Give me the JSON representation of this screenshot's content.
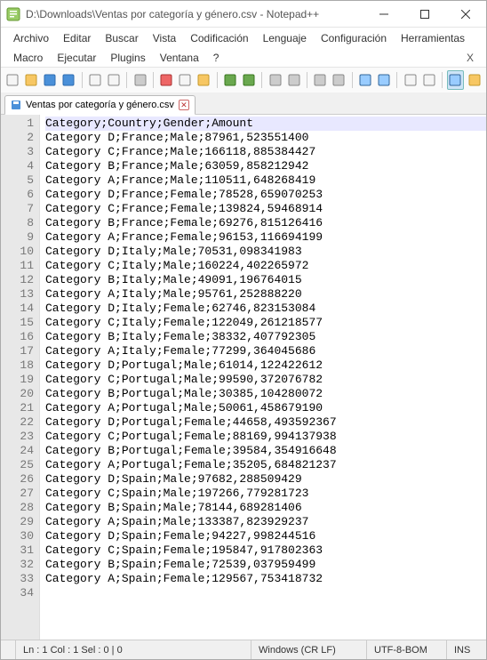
{
  "window": {
    "title": "D:\\Downloads\\Ventas por categoría y género.csv - Notepad++"
  },
  "menu": {
    "row1": [
      "Archivo",
      "Editar",
      "Buscar",
      "Vista",
      "Codificación",
      "Lenguaje",
      "Configuración",
      "Herramientas"
    ],
    "row2": [
      "Macro",
      "Ejecutar",
      "Plugins",
      "Ventana",
      "?"
    ]
  },
  "tab": {
    "label": "Ventas por categoría y género.csv"
  },
  "editor": {
    "lines": [
      "Category;Country;Gender;Amount",
      "Category D;France;Male;87961,523551400",
      "Category C;France;Male;166118,885384427",
      "Category B;France;Male;63059,858212942",
      "Category A;France;Male;110511,648268419",
      "Category D;France;Female;78528,659070253",
      "Category C;France;Female;139824,59468914",
      "Category B;France;Female;69276,815126416",
      "Category A;France;Female;96153,116694199",
      "Category D;Italy;Male;70531,098341983",
      "Category C;Italy;Male;160224,402265972",
      "Category B;Italy;Male;49091,196764015",
      "Category A;Italy;Male;95761,252888220",
      "Category D;Italy;Female;62746,823153084",
      "Category C;Italy;Female;122049,261218577",
      "Category B;Italy;Female;38332,407792305",
      "Category A;Italy;Female;77299,364045686",
      "Category D;Portugal;Male;61014,122422612",
      "Category C;Portugal;Male;99590,372076782",
      "Category B;Portugal;Male;30385,104280072",
      "Category A;Portugal;Male;50061,458679190",
      "Category D;Portugal;Female;44658,493592367",
      "Category C;Portugal;Female;88169,994137938",
      "Category B;Portugal;Female;39584,354916648",
      "Category A;Portugal;Female;35205,684821237",
      "Category D;Spain;Male;97682,288509429",
      "Category C;Spain;Male;197266,779281723",
      "Category B;Spain;Male;78144,689281406",
      "Category A;Spain;Male;133387,823929237",
      "Category D;Spain;Female;94227,998244516",
      "Category C;Spain;Female;195847,917802363",
      "Category B;Spain;Female;72539,037959499",
      "Category A;Spain;Female;129567,753418732",
      ""
    ]
  },
  "status": {
    "pos": "Ln : 1    Col : 1    Sel : 0 | 0",
    "eol": "Windows (CR LF)",
    "enc": "UTF-8-BOM",
    "mode": "INS"
  },
  "icons": {
    "toolbar_count": 26
  }
}
